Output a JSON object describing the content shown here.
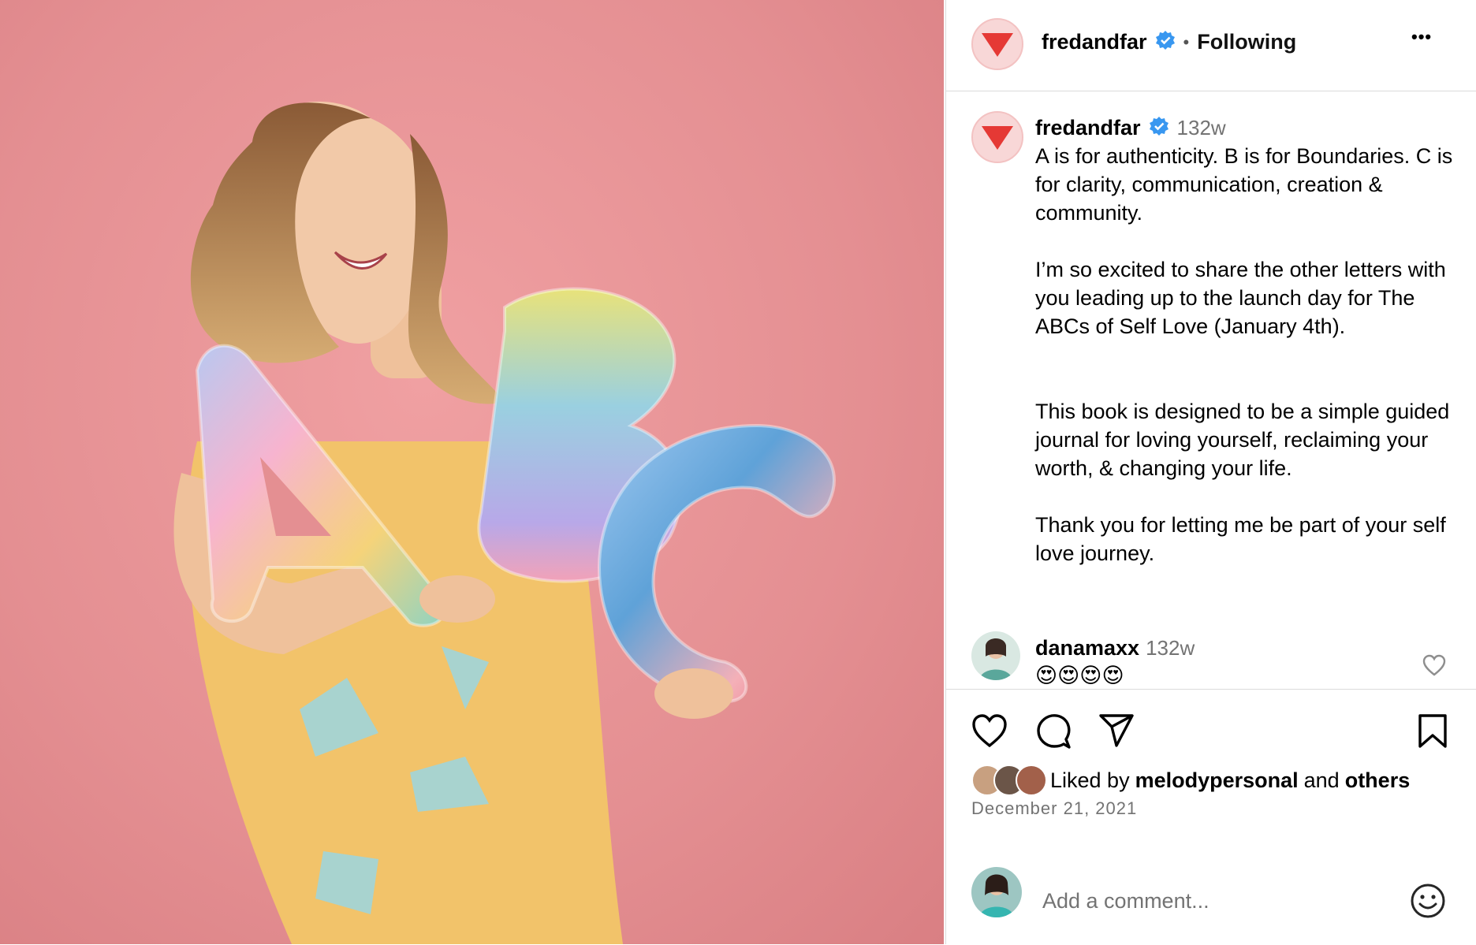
{
  "post": {
    "author": "fredandfar",
    "follow_state": "Following",
    "separator": "•",
    "more_label": "•••"
  },
  "caption": {
    "author": "fredandfar",
    "time": "132w",
    "text": "A is for authenticity. B is for Boundaries. C is for clarity, communication, creation & community.\n\nI’m so excited to share the other letters with you leading up to the launch day for The ABCs of Self Love (January 4th).\n\n\nThis book is designed to be a simple guided journal for loving yourself, reclaiming your worth, & changing your life.\n\nThank you for letting me be part of your self love journey."
  },
  "comments": [
    {
      "author": "danamaxx",
      "time": "132w",
      "text": "😍😍😍😍"
    }
  ],
  "likes": {
    "prefix": "Liked by",
    "user": "melodypersonal",
    "conjunction": "and",
    "suffix": "others"
  },
  "date": "December 21, 2021",
  "comment_box": {
    "placeholder": "Add a comment..."
  },
  "photo": {
    "balloon_letters": "ABC"
  },
  "colors": {
    "brand_red": "#e53935",
    "verified_blue": "#3897f0",
    "photo_background": "#e48f92"
  }
}
